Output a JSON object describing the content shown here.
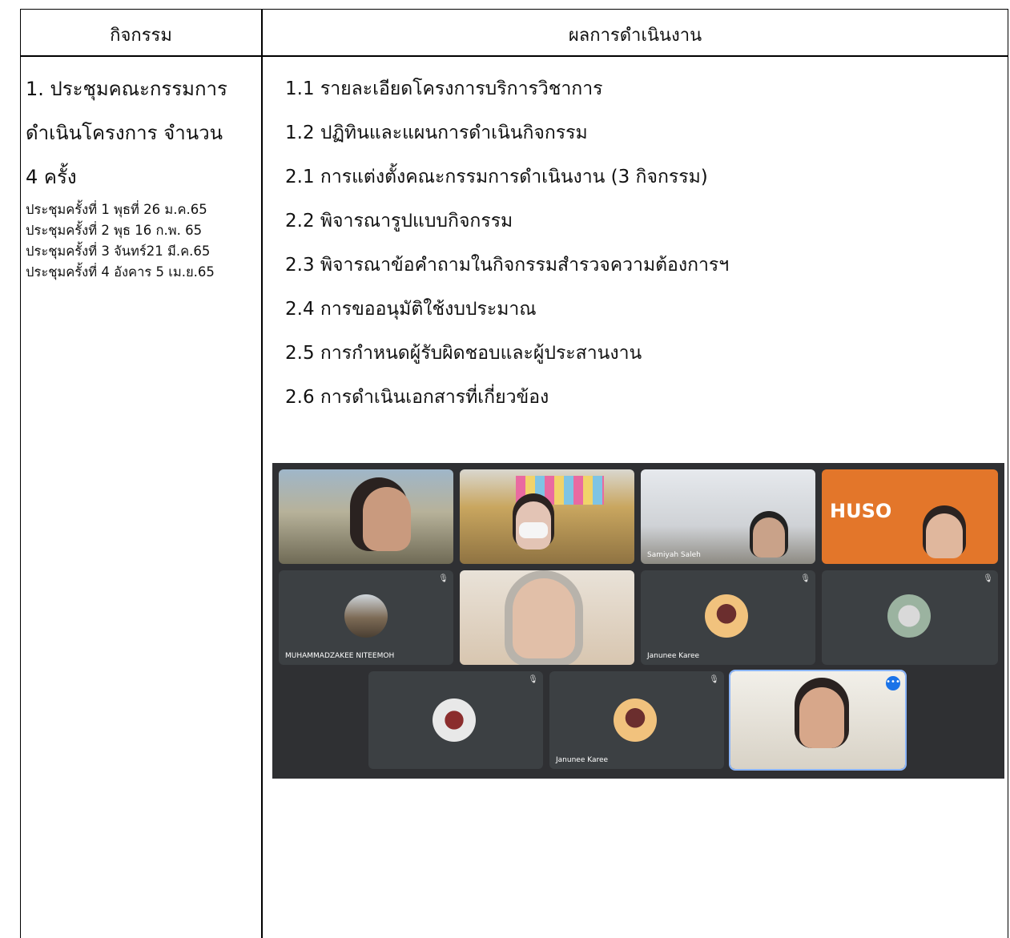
{
  "header": {
    "col1": "กิจกรรม",
    "col2": "ผลการดำเนินงาน"
  },
  "activity": {
    "title_lines": [
      "1. ประชุมคณะกรรมการ",
      "ดำเนินโครงการ จำนวน",
      "4 ครั้ง"
    ],
    "meetings": [
      "ประชุมครั้งที่ 1  พุธที่ 26 ม.ค.65",
      "ประชุมครั้งที่ 2 พุธ 16 ก.พ. 65",
      "ประชุมครั้งที่ 3  จันทร์21 มี.ค.65",
      "ประชุมครั้งที่ 4  อังคาร 5 เม.ย.65"
    ]
  },
  "results": [
    "1.1 รายละเอียดโครงการบริการวิชาการ",
    "1.2 ปฏิทินและแผนการดำเนินกิจกรรม",
    "2.1 การแต่งตั้งคณะกรรมการดำเนินงาน (3 กิจกรรม)",
    "2.2 พิจารณารูปแบบกิจกรรม",
    "2.3 พิจารณาข้อคำถามในกิจกรรมสำรวจความต้องการฯ",
    "2.4 การขออนุมัติใช้งบประมาณ",
    "2.5 การกำหนดผู้รับผิดชอบและผู้ประสานงาน",
    "2.6 การดำเนินเอกสารที่เกี่ยวข้อง"
  ],
  "video_call": {
    "participants": [
      "Samiyah Saleh",
      "MUHAMMADZAKEE NITEEMOH",
      "Janunee Karee",
      "Janunee Karee"
    ],
    "brand_text": "HUSO"
  }
}
